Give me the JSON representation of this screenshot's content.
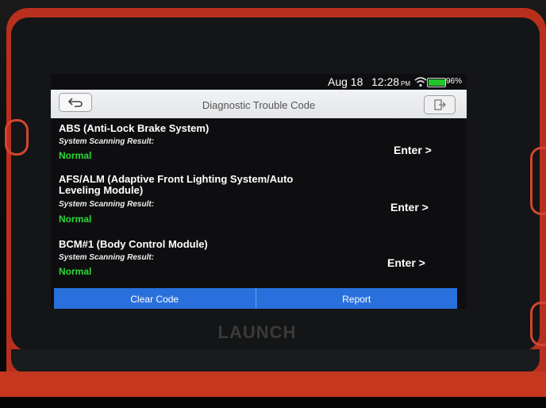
{
  "device": {
    "brand": "LAUNCH"
  },
  "status_bar": {
    "date": "Aug 18",
    "time": "12:28",
    "ampm": "PM",
    "battery": "96%",
    "battery_level": 0.96,
    "battery_color": "#22c52a"
  },
  "header": {
    "title": "Diagnostic Trouble Code",
    "back_icon": "back-arrow-icon",
    "exit_icon": "exit-icon"
  },
  "systems": [
    {
      "name": "ABS (Anti-Lock Brake System)",
      "label": "System Scanning Result:",
      "status": "Normal",
      "action": "Enter >"
    },
    {
      "name": "AFS/ALM (Adaptive Front Lighting System/Auto Leveling Module)",
      "label": "System Scanning Result:",
      "status": "Normal",
      "action": "Enter >"
    },
    {
      "name": "BCM#1 (Body Control Module)",
      "label": "System Scanning Result:",
      "status": "Normal",
      "action": "Enter >"
    }
  ],
  "footer": {
    "clear_code": "Clear Code",
    "report": "Report"
  },
  "colors": {
    "accent": "#2a70dd",
    "status_normal": "#2bd936"
  }
}
